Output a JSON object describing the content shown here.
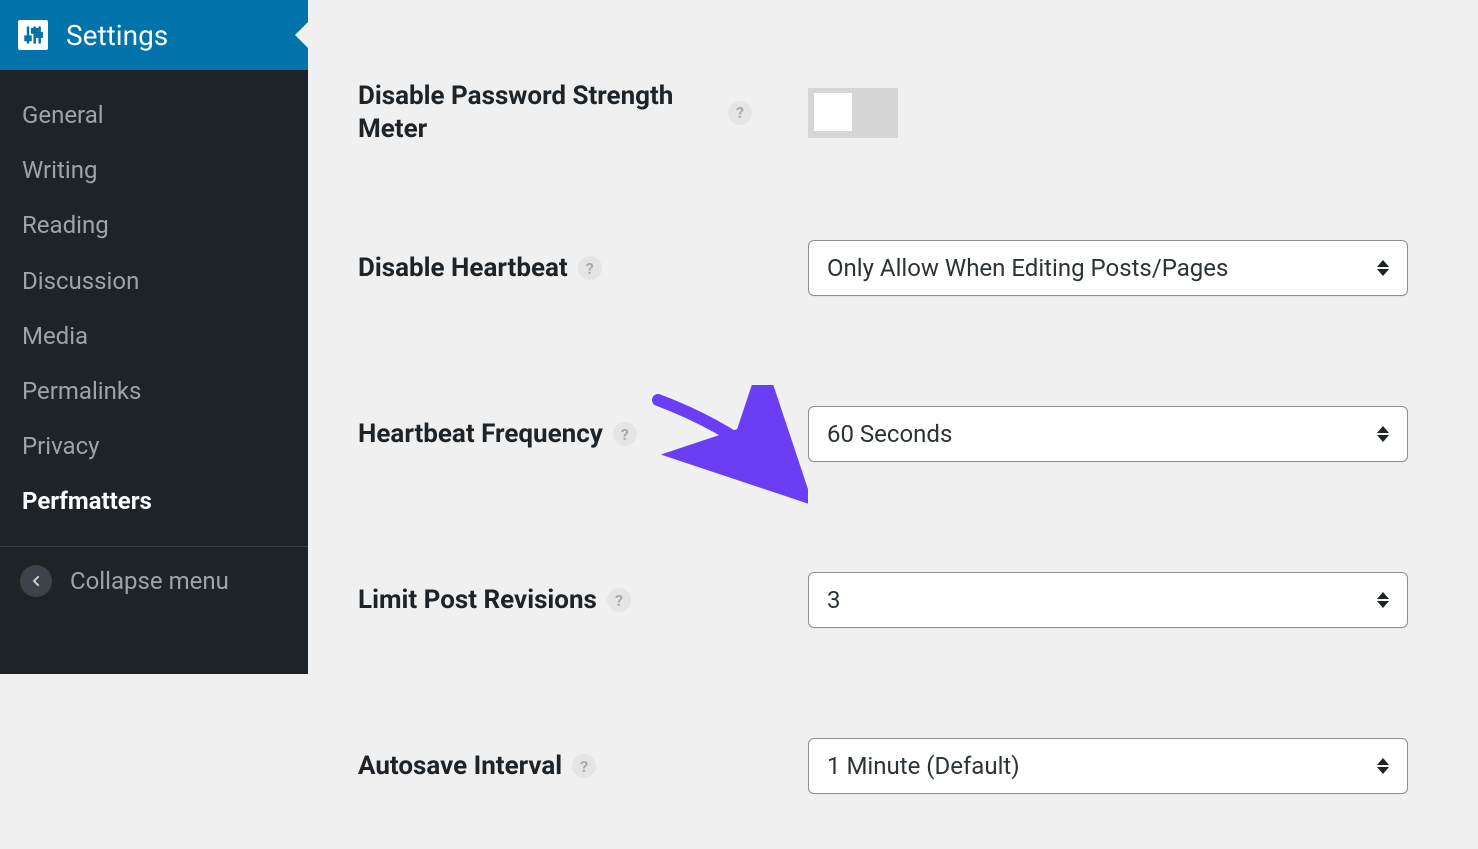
{
  "sidebar": {
    "title": "Settings",
    "items": [
      {
        "label": "General",
        "slug": "general",
        "active": false
      },
      {
        "label": "Writing",
        "slug": "writing",
        "active": false
      },
      {
        "label": "Reading",
        "slug": "reading",
        "active": false
      },
      {
        "label": "Discussion",
        "slug": "discussion",
        "active": false
      },
      {
        "label": "Media",
        "slug": "media",
        "active": false
      },
      {
        "label": "Permalinks",
        "slug": "permalinks",
        "active": false
      },
      {
        "label": "Privacy",
        "slug": "privacy",
        "active": false
      },
      {
        "label": "Perfmatters",
        "slug": "perfmatters",
        "active": true
      }
    ],
    "collapse_label": "Collapse menu"
  },
  "settings": {
    "disable_password_meter": {
      "label": "Disable Password Strength Meter",
      "help": "?",
      "value": false
    },
    "disable_heartbeat": {
      "label": "Disable Heartbeat",
      "help": "?",
      "value": "Only Allow When Editing Posts/Pages"
    },
    "heartbeat_frequency": {
      "label": "Heartbeat Frequency",
      "help": "?",
      "value": "60 Seconds"
    },
    "limit_post_revisions": {
      "label": "Limit Post Revisions",
      "help": "?",
      "value": "3"
    },
    "autosave_interval": {
      "label": "Autosave Interval",
      "help": "?",
      "value": "1 Minute (Default)"
    }
  },
  "annotation": {
    "color": "#6a3ef5"
  }
}
